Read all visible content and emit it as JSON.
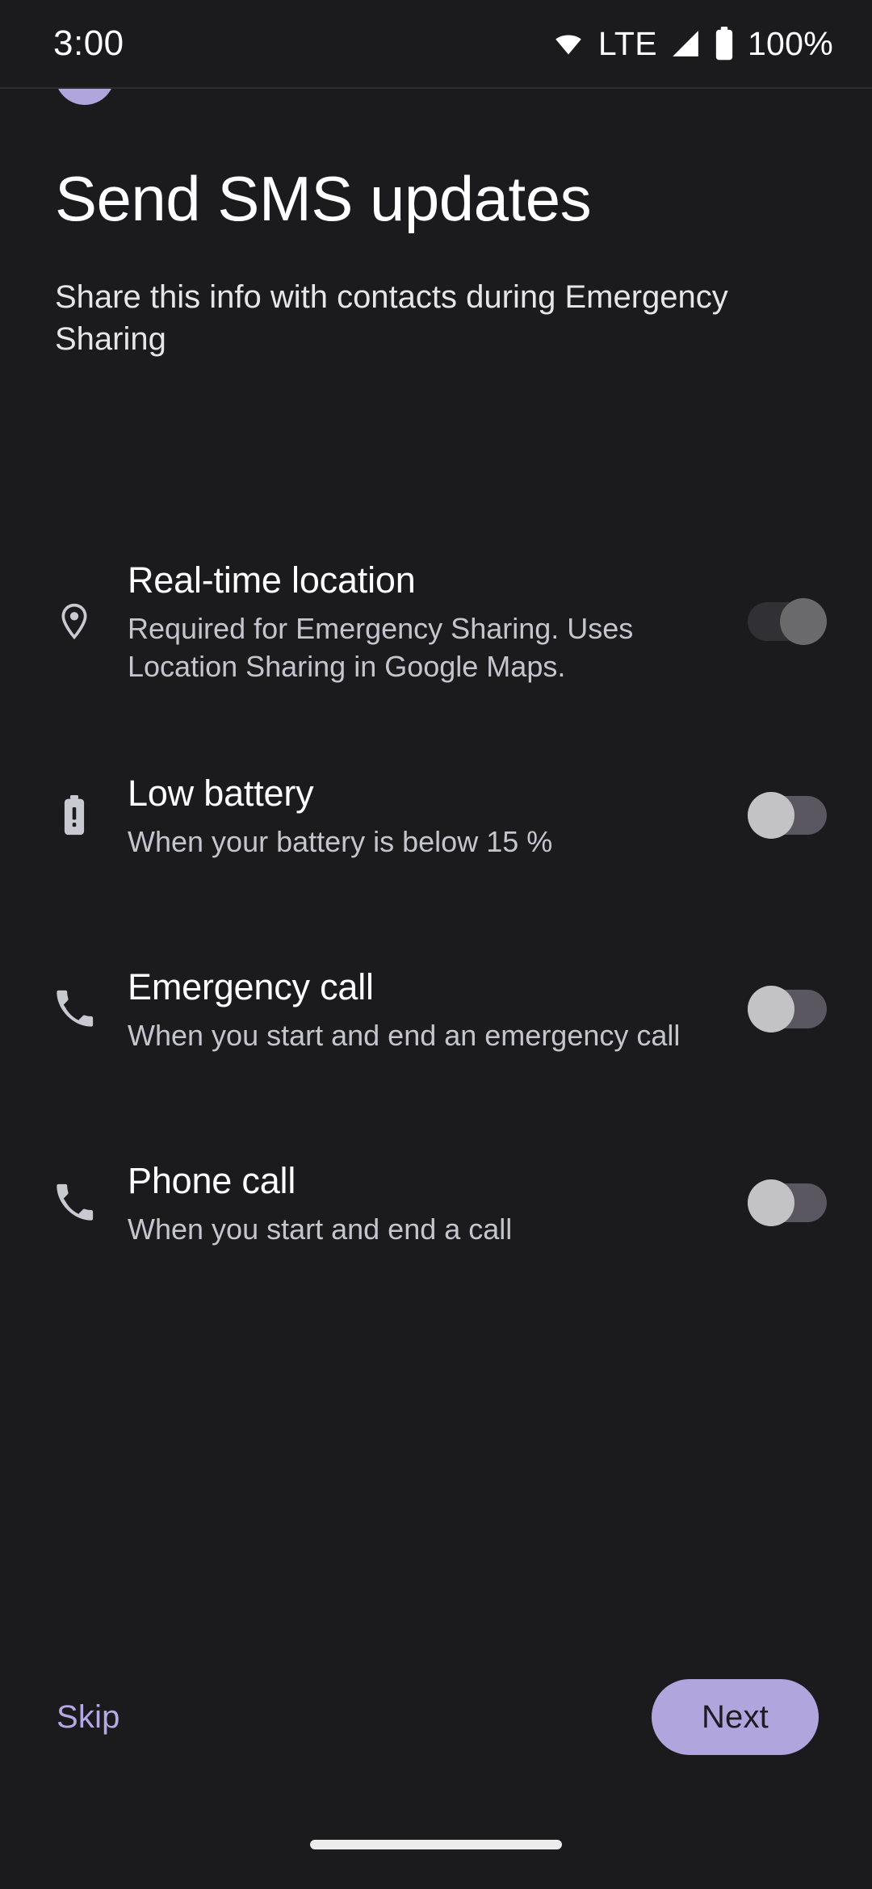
{
  "status_bar": {
    "time": "3:00",
    "network_label": "LTE",
    "battery_label": "100%",
    "icons": [
      "wifi-icon",
      "signal-icon",
      "battery-icon"
    ]
  },
  "header": {
    "title": "Send SMS updates",
    "subtitle": "Share this info with contacts during Emergency Sharing"
  },
  "settings": {
    "items": [
      {
        "icon": "location-pin-icon",
        "title": "Real-time location",
        "description": "Required for Emergency Sharing. Uses Location Sharing in Google Maps.",
        "toggle_state": "on-disabled"
      },
      {
        "icon": "battery-low-icon",
        "title": "Low battery",
        "description": "When your battery is below 15 %",
        "toggle_state": "off"
      },
      {
        "icon": "phone-icon",
        "title": "Emergency call",
        "description": "When you start and end an emergency call",
        "toggle_state": "off"
      },
      {
        "icon": "phone-icon",
        "title": "Phone call",
        "description": "When you start and end a call",
        "toggle_state": "off"
      }
    ]
  },
  "actions": {
    "skip_label": "Skip",
    "next_label": "Next"
  },
  "colors": {
    "background": "#1b1b1e",
    "accent": "#b0a5dd",
    "skip_text": "#b6a8e4",
    "title_text": "#ffffff",
    "description_text": "#c5c5cd"
  }
}
